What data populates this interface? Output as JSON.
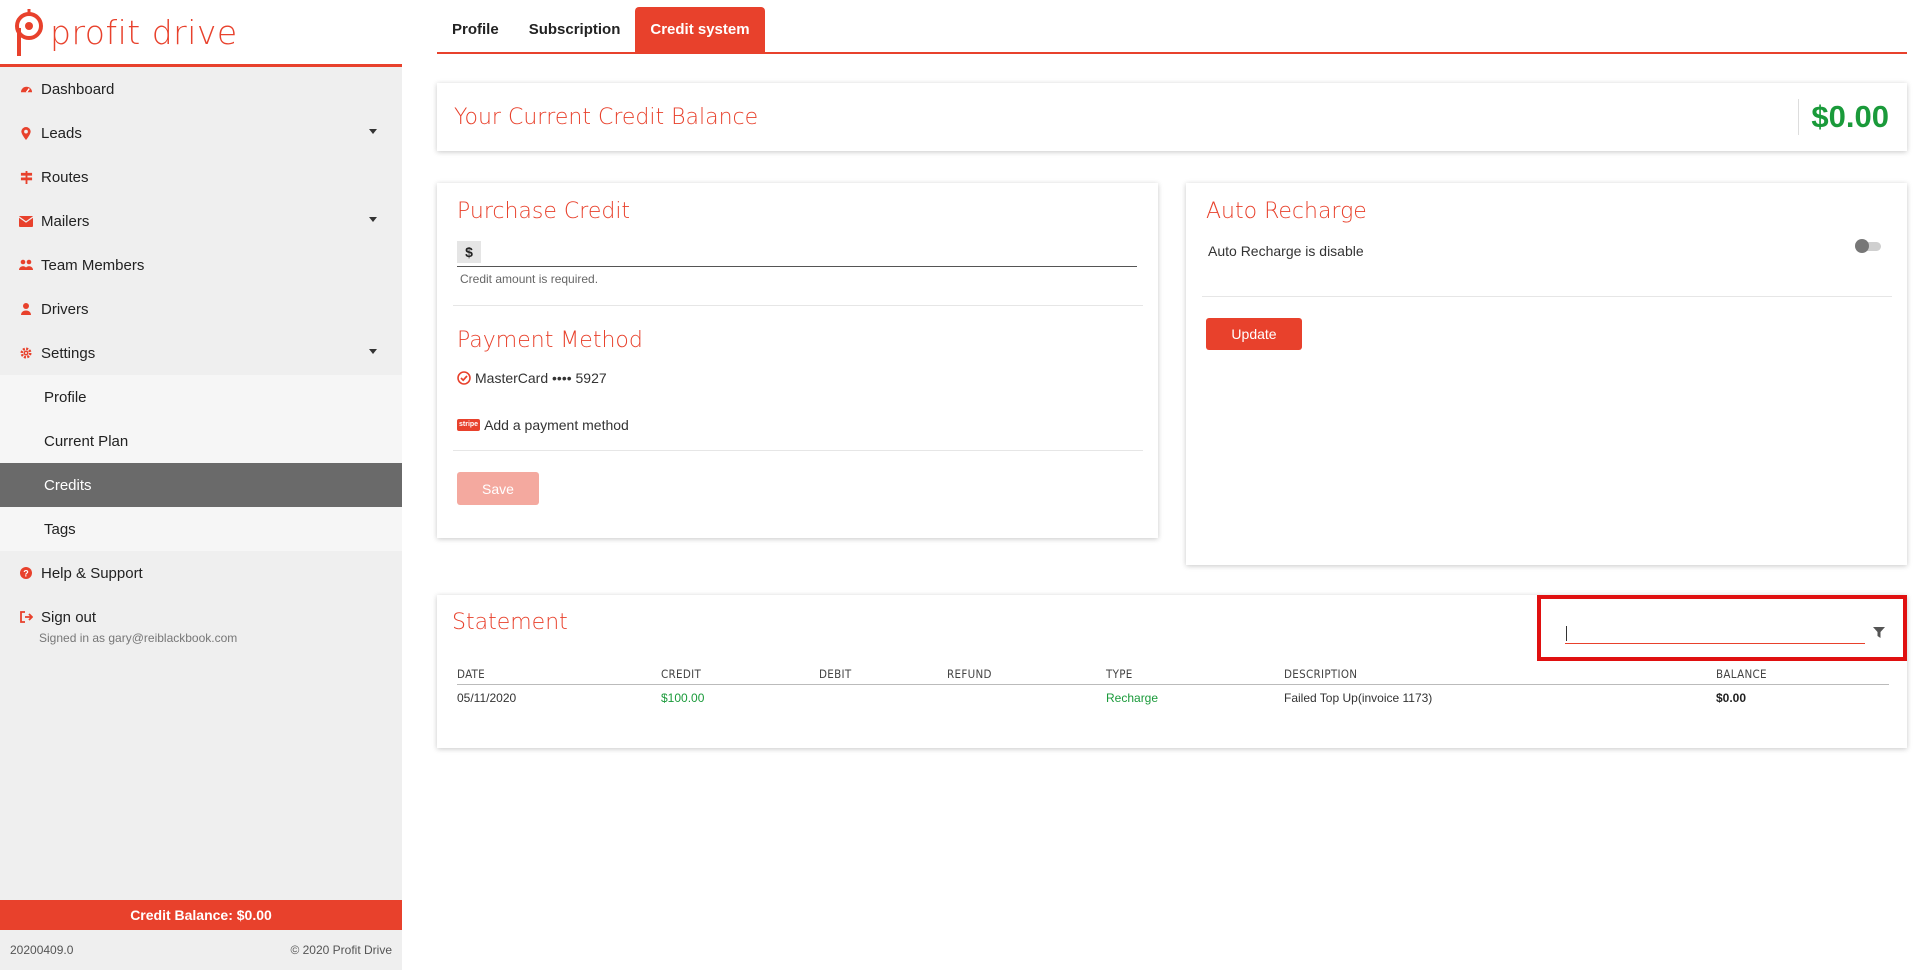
{
  "colors": {
    "accent": "#e8412c",
    "positive": "#1a9a3a",
    "active_sidebar": "#6a6a6a",
    "highlight_box": "#e01010"
  },
  "brand": {
    "name": "profit drive"
  },
  "sidebar": {
    "items": [
      {
        "label": "Dashboard",
        "icon": "dashboard-icon"
      },
      {
        "label": "Leads",
        "icon": "map-pin-icon",
        "expandable": true
      },
      {
        "label": "Routes",
        "icon": "signpost-icon"
      },
      {
        "label": "Mailers",
        "icon": "envelope-icon",
        "expandable": true
      },
      {
        "label": "Team Members",
        "icon": "users-icon"
      },
      {
        "label": "Drivers",
        "icon": "user-icon"
      },
      {
        "label": "Settings",
        "icon": "gear-icon",
        "expandable": true
      }
    ],
    "settings_sub": [
      {
        "label": "Profile"
      },
      {
        "label": "Current Plan"
      },
      {
        "label": "Credits",
        "active": true
      },
      {
        "label": "Tags"
      }
    ],
    "help": {
      "label": "Help & Support",
      "icon": "question-circle-icon"
    },
    "signout": {
      "label": "Sign out",
      "icon": "sign-out-icon"
    },
    "signed_in": "Signed in as gary@reiblackbook.com",
    "credit_balance": "Credit Balance: $0.00",
    "version": "20200409.0",
    "copyright": "© 2020 Profit Drive"
  },
  "tabs": [
    {
      "label": "Profile"
    },
    {
      "label": "Subscription"
    },
    {
      "label": "Credit system",
      "active": true
    }
  ],
  "balance": {
    "title": "Your Current Credit Balance",
    "amount": "$0.00"
  },
  "purchase": {
    "title": "Purchase Credit",
    "currency": "$",
    "amount_value": "",
    "helper": "Credit amount is required.",
    "payment_title": "Payment Method",
    "card_label": "MasterCard •••• 5927",
    "stripe_badge": "stripe",
    "add_method": "Add a payment method",
    "save_label": "Save"
  },
  "auto_recharge": {
    "title": "Auto Recharge",
    "status": "Auto Recharge is disable",
    "enabled": false,
    "update_label": "Update"
  },
  "statement": {
    "title": "Statement",
    "filter_value": "",
    "columns": [
      "DATE",
      "CREDIT",
      "DEBIT",
      "REFUND",
      "TYPE",
      "DESCRIPTION",
      "BALANCE"
    ],
    "rows": [
      {
        "date": "05/11/2020",
        "credit": "$100.00",
        "debit": "",
        "refund": "",
        "type": "Recharge",
        "description": "Failed Top Up(invoice 1173)",
        "balance": "$0.00"
      }
    ]
  }
}
